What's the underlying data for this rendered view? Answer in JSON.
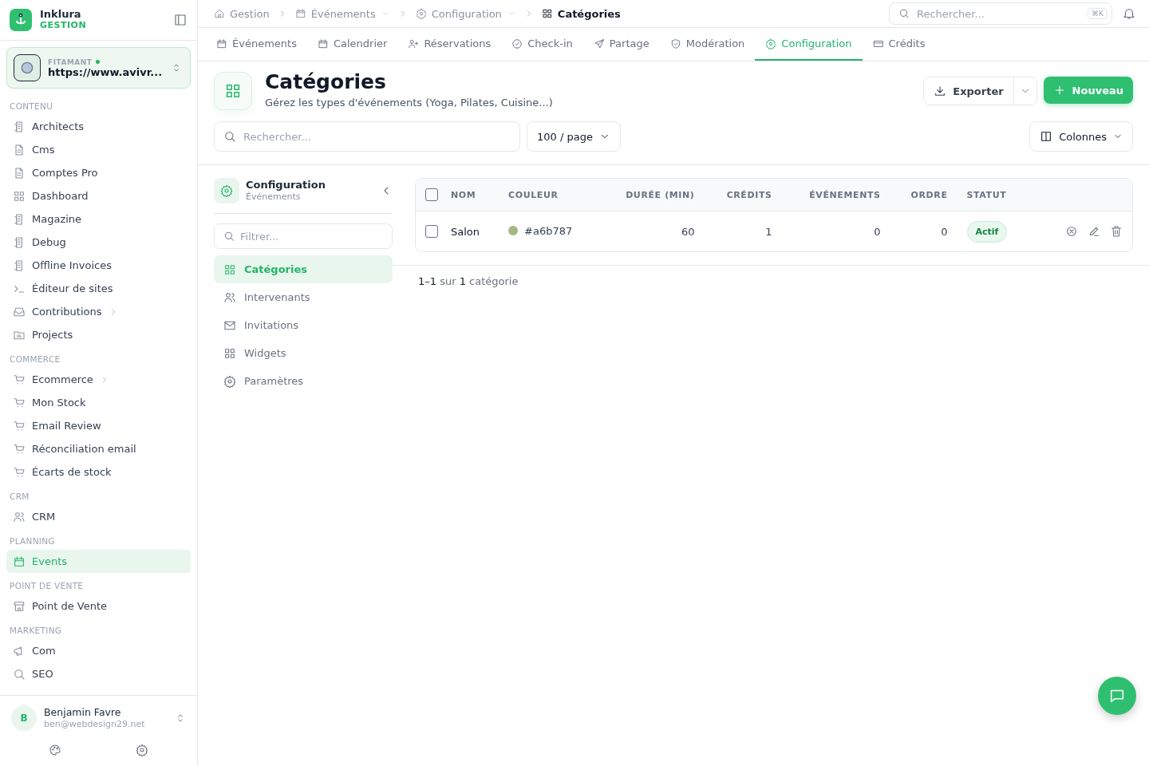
{
  "brand": {
    "name": "Inklura",
    "subtitle": "GESTION"
  },
  "workspace": {
    "label": "FITAMANT",
    "online": true,
    "url": "https://www.avivr..."
  },
  "sidebar": {
    "sections": [
      {
        "title": "CONTENU",
        "items": [
          {
            "label": "Architects",
            "kind": "doc",
            "selected": false,
            "has_children": false
          },
          {
            "label": "Cms",
            "kind": "file",
            "selected": false,
            "has_children": false
          },
          {
            "label": "Comptes Pro",
            "kind": "file",
            "selected": false,
            "has_children": false
          },
          {
            "label": "Dashboard",
            "kind": "grid",
            "selected": false,
            "has_children": false
          },
          {
            "label": "Magazine",
            "kind": "doc",
            "selected": false,
            "has_children": false
          },
          {
            "label": "Debug",
            "kind": "doc",
            "selected": false,
            "has_children": false
          },
          {
            "label": "Offline Invoices",
            "kind": "doc",
            "selected": false,
            "has_children": false
          },
          {
            "label": "Éditeur de sites",
            "kind": "terminal",
            "selected": false,
            "has_children": false
          },
          {
            "label": "Contributions",
            "kind": "inbox",
            "selected": false,
            "has_children": true
          },
          {
            "label": "Projects",
            "kind": "folder",
            "selected": false,
            "has_children": false
          }
        ]
      },
      {
        "title": "COMMERCE",
        "items": [
          {
            "label": "Ecommerce",
            "kind": "cart",
            "selected": false,
            "has_children": true
          },
          {
            "label": "Mon Stock",
            "kind": "cart",
            "selected": false,
            "has_children": false
          },
          {
            "label": "Email Review",
            "kind": "cart",
            "selected": false,
            "has_children": false
          },
          {
            "label": "Réconciliation email",
            "kind": "cart",
            "selected": false,
            "has_children": false
          },
          {
            "label": "Écarts de stock",
            "kind": "cart",
            "selected": false,
            "has_children": false
          }
        ]
      },
      {
        "title": "CRM",
        "items": [
          {
            "label": "CRM",
            "kind": "users",
            "selected": false,
            "has_children": false
          }
        ]
      },
      {
        "title": "PLANNING",
        "items": [
          {
            "label": "Events",
            "kind": "calendar",
            "selected": true,
            "has_children": false
          }
        ]
      },
      {
        "title": "POINT DE VENTE",
        "items": [
          {
            "label": "Point de Vente",
            "kind": "store",
            "selected": false,
            "has_children": false
          }
        ]
      },
      {
        "title": "MARKETING",
        "items": [
          {
            "label": "Com",
            "kind": "megaphone",
            "selected": false,
            "has_children": false
          },
          {
            "label": "SEO",
            "kind": "search",
            "selected": false,
            "has_children": false
          }
        ]
      }
    ]
  },
  "user": {
    "initial": "B",
    "name": "Benjamin Favre",
    "email": "ben@webdesign29.net"
  },
  "breadcrumb": [
    {
      "label": "Gestion",
      "kind": "home",
      "dropdown": false,
      "current": false
    },
    {
      "label": "Événements",
      "kind": "calendar",
      "dropdown": true,
      "current": false
    },
    {
      "label": "Configuration",
      "kind": "gear",
      "dropdown": true,
      "current": false
    },
    {
      "label": "Catégories",
      "kind": "grid",
      "dropdown": false,
      "current": true
    }
  ],
  "global_search": {
    "placeholder": "Rechercher...",
    "shortcut": "⌘K"
  },
  "tabs": [
    {
      "label": "Événements",
      "kind": "calendar",
      "selected": false
    },
    {
      "label": "Calendrier",
      "kind": "calendar",
      "selected": false
    },
    {
      "label": "Réservations",
      "kind": "useradd",
      "selected": false
    },
    {
      "label": "Check-in",
      "kind": "check",
      "selected": false
    },
    {
      "label": "Partage",
      "kind": "send",
      "selected": false
    },
    {
      "label": "Modération",
      "kind": "shield",
      "selected": false
    },
    {
      "label": "Configuration",
      "kind": "gear",
      "selected": true
    },
    {
      "label": "Crédits",
      "kind": "card",
      "selected": false
    }
  ],
  "page": {
    "title": "Catégories",
    "subtitle": "Gérez les types d'événements (Yoga, Pilates, Cuisine...)",
    "export_label": "Exporter",
    "new_label": "Nouveau"
  },
  "toolbar": {
    "search_placeholder": "Rechercher...",
    "page_size": "100 / page",
    "columns_label": "Colonnes"
  },
  "config_nav": {
    "title": "Configuration",
    "subtitle": "Événements",
    "filter_placeholder": "Filtrer...",
    "items": [
      {
        "label": "Catégories",
        "kind": "grid",
        "selected": true
      },
      {
        "label": "Intervenants",
        "kind": "users",
        "selected": false
      },
      {
        "label": "Invitations",
        "kind": "mail",
        "selected": false
      },
      {
        "label": "Widgets",
        "kind": "grid",
        "selected": false
      },
      {
        "label": "Paramètres",
        "kind": "gear",
        "selected": false
      }
    ]
  },
  "table": {
    "all_checked": false,
    "columns": [
      {
        "label": "NOM",
        "kind": "text"
      },
      {
        "label": "COULEUR",
        "kind": "color"
      },
      {
        "label": "DURÉE (MIN)",
        "kind": "number"
      },
      {
        "label": "CRÉDITS",
        "kind": "number"
      },
      {
        "label": "ÉVÉNEMENTS",
        "kind": "number"
      },
      {
        "label": "ORDRE",
        "kind": "number"
      },
      {
        "label": "STATUT",
        "kind": "status"
      }
    ],
    "rows": [
      {
        "checked": false,
        "cells": [
          {
            "text": "Salon"
          },
          {
            "text": "#a6b787",
            "color": "#a6b787"
          },
          {
            "text": "60"
          },
          {
            "text": "1"
          },
          {
            "text": "0"
          },
          {
            "text": "0"
          },
          {
            "text": "Actif",
            "active": true
          }
        ]
      }
    ]
  },
  "pagination": "**1–1** sur **1** catégorie"
}
